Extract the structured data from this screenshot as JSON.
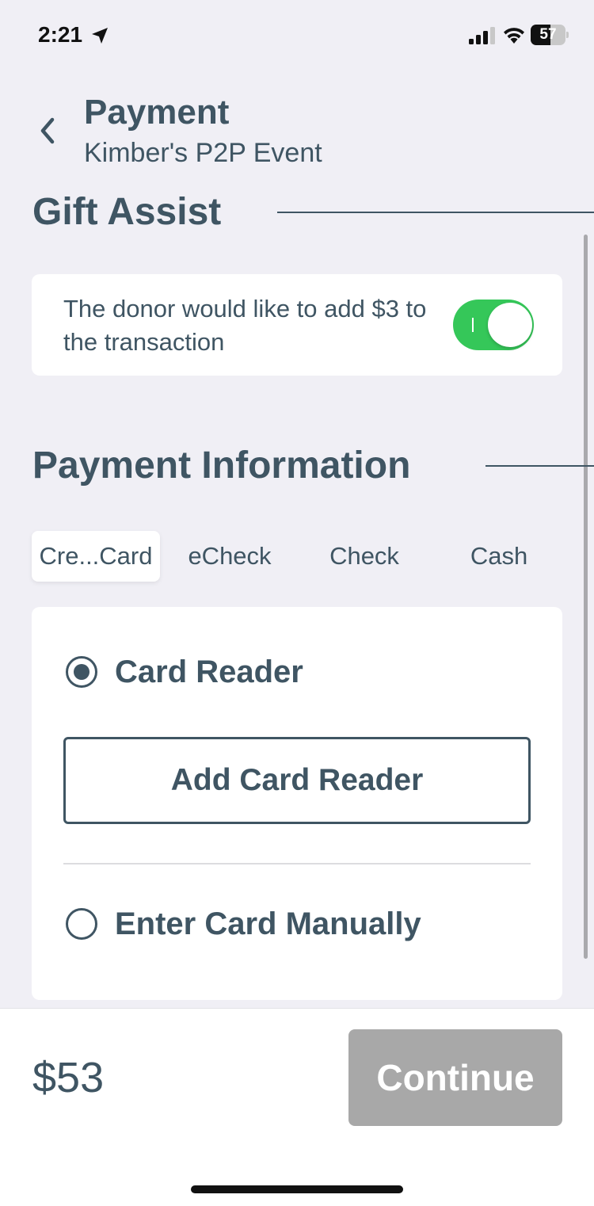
{
  "status_bar": {
    "time": "2:21",
    "battery_level": "57",
    "battery_fraction": 0.57
  },
  "header": {
    "back_icon": "chevron-left-icon",
    "title": "Payment",
    "subtitle": "Kimber's P2P Event"
  },
  "gift_assist": {
    "section_title": "Gift Assist",
    "description": "The donor would like to add $3 to the transaction",
    "toggle_on": true,
    "toggle_color": "#35c759"
  },
  "payment_information": {
    "section_title": "Payment Information",
    "tabs": [
      {
        "label": "Cre...Card",
        "active": true
      },
      {
        "label": "eCheck",
        "active": false
      },
      {
        "label": "Check",
        "active": false
      },
      {
        "label": "Cash",
        "active": false
      }
    ],
    "options": {
      "card_reader": {
        "label": "Card Reader",
        "selected": true
      },
      "add_card_reader_label": "Add Card Reader",
      "enter_manually": {
        "label": "Enter Card Manually",
        "selected": false
      }
    }
  },
  "footer": {
    "total": "$53",
    "continue_label": "Continue",
    "continue_enabled": false
  },
  "colors": {
    "primary_text": "#3f5563",
    "background": "#f0eff5",
    "disabled_button": "#a8a8a8"
  }
}
